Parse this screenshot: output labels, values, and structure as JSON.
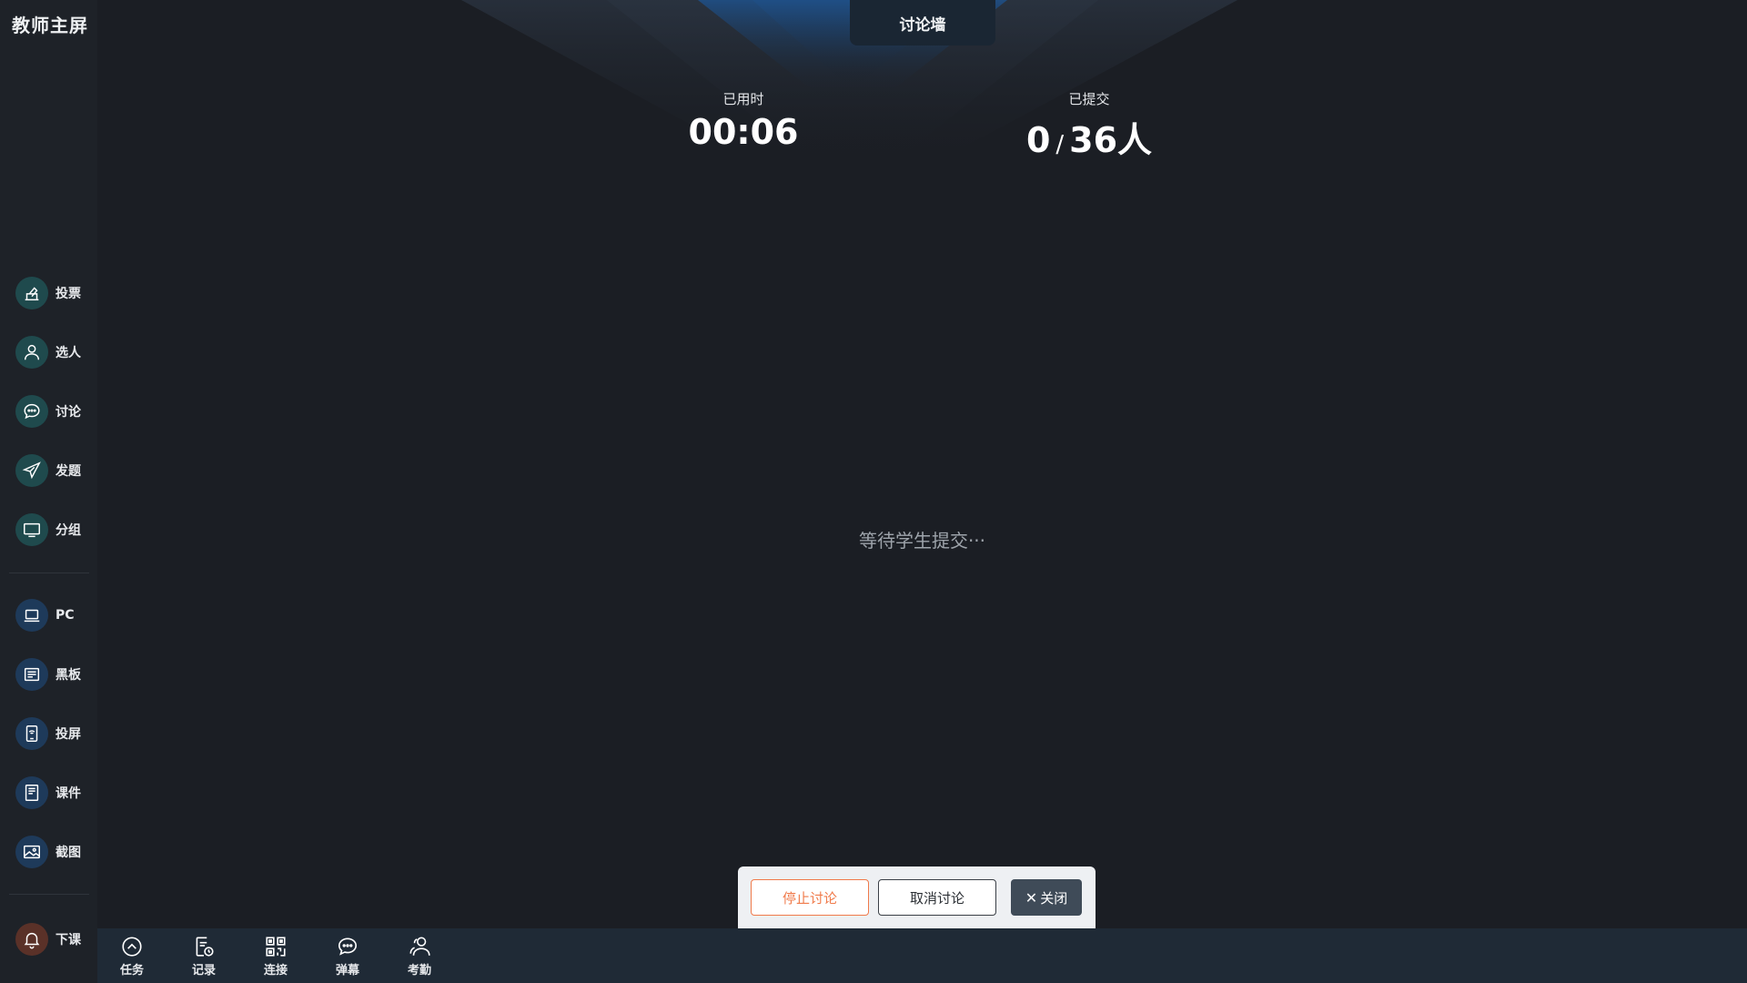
{
  "app": {
    "title": "教师主屏"
  },
  "sidebar": {
    "tools": [
      {
        "label": "投票",
        "icon": "vote-icon"
      },
      {
        "label": "选人",
        "icon": "person-icon"
      },
      {
        "label": "讨论",
        "icon": "chat-icon"
      },
      {
        "label": "发题",
        "icon": "send-icon"
      },
      {
        "label": "分组",
        "icon": "monitor-icon"
      }
    ],
    "screens": [
      {
        "label": "PC",
        "icon": "laptop-icon"
      },
      {
        "label": "黑板",
        "icon": "blackboard-icon"
      },
      {
        "label": "投屏",
        "icon": "cast-icon"
      },
      {
        "label": "课件",
        "icon": "courseware-icon"
      },
      {
        "label": "截图",
        "icon": "screenshot-icon"
      }
    ],
    "end_class": {
      "label": "下课",
      "icon": "bell-icon"
    }
  },
  "header": {
    "tab_title": "讨论墙"
  },
  "stats": {
    "elapsed_label": "已用时",
    "elapsed_value": "00:06",
    "submitted_label": "已提交",
    "submitted_count": "0",
    "submitted_sep": "/",
    "submitted_total": "36人"
  },
  "main": {
    "waiting_text": "等待学生提交···"
  },
  "actions": {
    "stop_label": "停止讨论",
    "cancel_label": "取消讨论",
    "close_label": "关闭"
  },
  "bottombar": {
    "items": [
      {
        "label": "任务",
        "icon": "task-icon"
      },
      {
        "label": "记录",
        "icon": "record-icon"
      },
      {
        "label": "连接",
        "icon": "qrcode-icon"
      },
      {
        "label": "弹幕",
        "icon": "bullet-comment-icon"
      },
      {
        "label": "考勤",
        "icon": "attendance-icon"
      }
    ]
  },
  "colors": {
    "background": "#1b1e24",
    "sidebar": "#1e2228",
    "accent_orange": "#f07a4a",
    "teal_icon_bg": "#1f4a4d",
    "blue_icon_bg": "#1e3a5a",
    "end_class_bg": "#5a3128"
  }
}
